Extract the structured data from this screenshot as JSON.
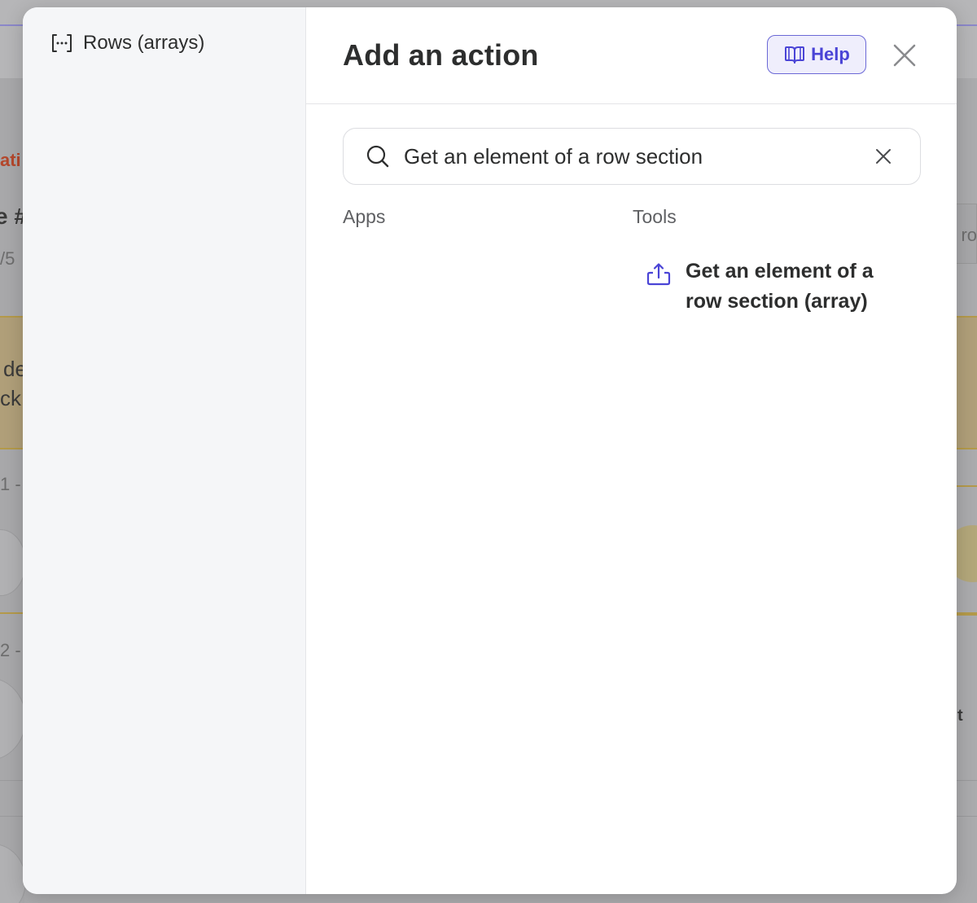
{
  "background": {
    "fragments": [
      "ati",
      "e #",
      "/5",
      "de",
      "ck",
      "1 -",
      "2 -",
      "ro",
      "t"
    ]
  },
  "modal": {
    "sidebar": {
      "items": [
        {
          "label": "Rows (arrays)",
          "icon": "array-brackets-icon"
        }
      ]
    },
    "title": "Add an action",
    "help_label": "Help",
    "search": {
      "value": "Get an element of a row section",
      "placeholder": "Search"
    },
    "columns": {
      "apps": "Apps",
      "tools": "Tools"
    },
    "tools": [
      {
        "label": "Get an element of a row section (array)",
        "icon": "export-upload-icon"
      }
    ]
  },
  "colors": {
    "accent": "#4a44d6",
    "accent_bg": "#efeefc",
    "text": "#2d2e2e",
    "muted": "#5f6063",
    "sidebar_bg": "#f5f6f8"
  }
}
